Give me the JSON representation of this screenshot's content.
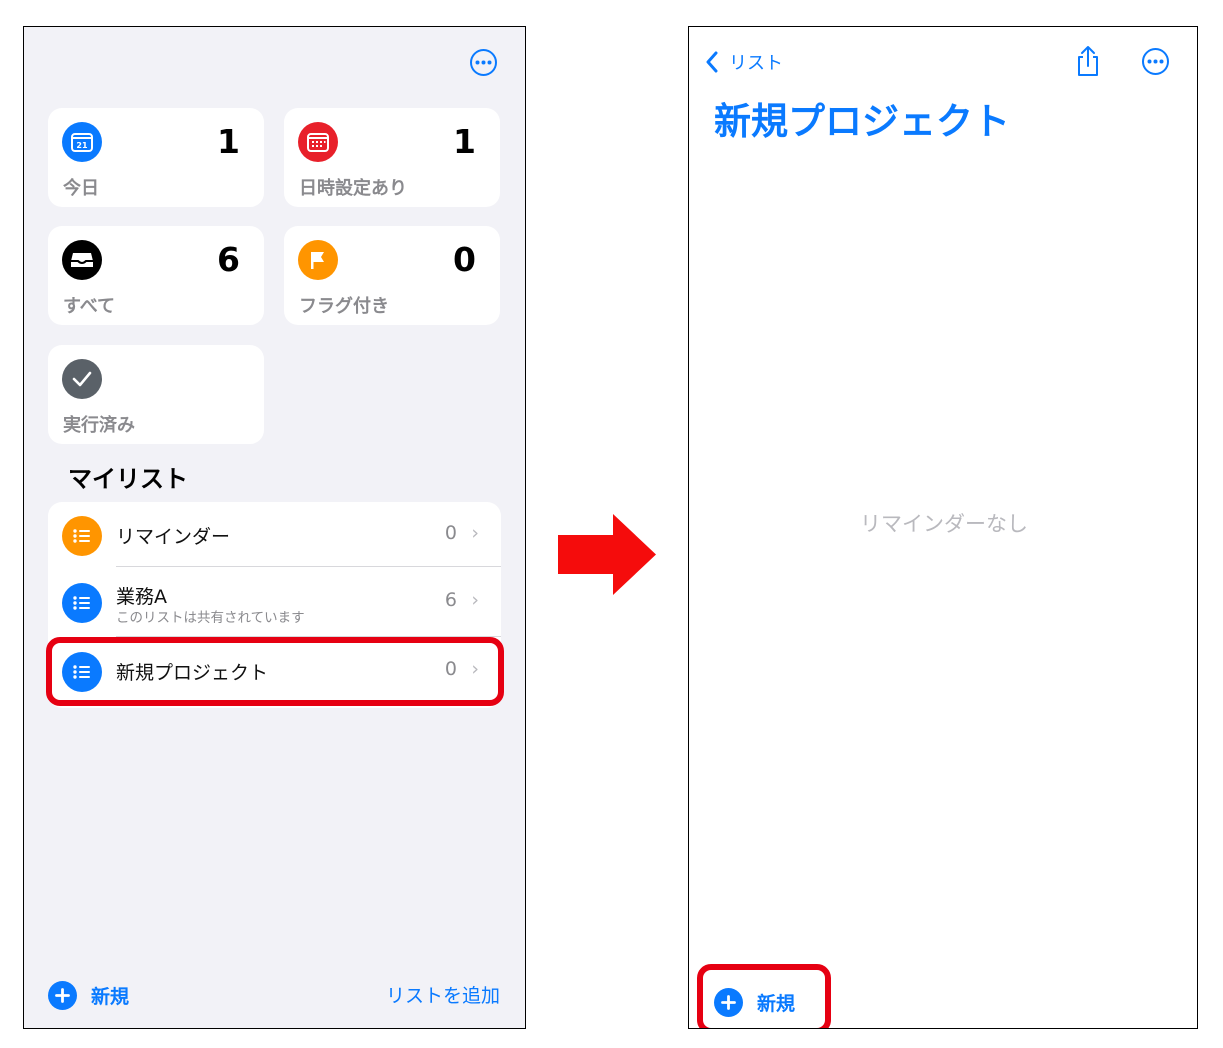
{
  "left_screen": {
    "cards": [
      {
        "id": "today",
        "label": "今日",
        "count": "1",
        "icon": "calendar-icon",
        "icon_text": "21",
        "color": "#0a7aff"
      },
      {
        "id": "scheduled",
        "label": "日時設定あり",
        "count": "1",
        "icon": "calendar-grid-icon",
        "color": "#e8202a"
      },
      {
        "id": "all",
        "label": "すべて",
        "count": "6",
        "icon": "tray-icon",
        "color": "#000000"
      },
      {
        "id": "flagged",
        "label": "フラグ付き",
        "count": "0",
        "icon": "flag-icon",
        "color": "#ff9500"
      },
      {
        "id": "completed",
        "label": "実行済み",
        "icon": "checkmark-icon",
        "color": "#5a6168"
      }
    ],
    "my_lists_heading": "マイリスト",
    "lists": [
      {
        "name": "リマインダー",
        "count": "0",
        "color": "#ff9500"
      },
      {
        "name": "業務A",
        "subtitle": "このリストは共有されています",
        "count": "6",
        "color": "#0a7aff"
      },
      {
        "name": "新規プロジェクト",
        "count": "0",
        "color": "#0a7aff"
      }
    ],
    "new_reminder_label": "新規",
    "add_list_label": "リストを追加"
  },
  "right_screen": {
    "back_label": "リスト",
    "title": "新規プロジェクト",
    "empty_message": "リマインダーなし",
    "new_reminder_label": "新規"
  },
  "colors": {
    "accent": "#0a7aff",
    "highlight": "#e60012",
    "arrow": "#f50c0c"
  }
}
